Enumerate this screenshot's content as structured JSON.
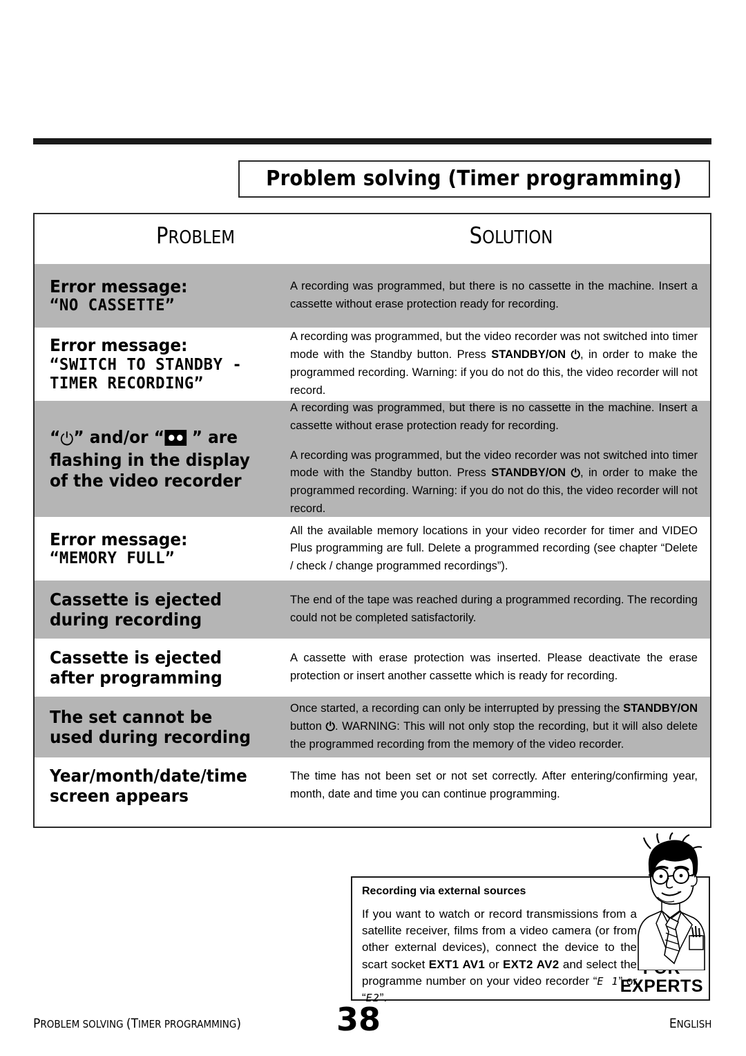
{
  "header": {
    "chapter_title": "Problem solving (Timer programming)"
  },
  "table": {
    "col_problem_header_first": "P",
    "col_problem_header_rest": "ROBLEM",
    "col_solution_header_first": "S",
    "col_solution_header_rest": "OLUTION",
    "rows": [
      {
        "shaded": true,
        "problem_lines": [
          {
            "text": "Error message:",
            "style": "normal"
          },
          {
            "text": "“NO  CASSETTE”",
            "style": "mono"
          }
        ],
        "solution_paragraphs": [
          "A recording was programmed, but there is no cassette in the machine. Insert a cassette without erase protection ready for recording."
        ]
      },
      {
        "shaded": false,
        "problem_lines": [
          {
            "text": "Error message:",
            "style": "normal"
          },
          {
            "text": "“SWITCH TO STANDBY -",
            "style": "mono"
          },
          {
            "text": "TIMER RECORDING”",
            "style": "mono"
          }
        ],
        "solution_paragraphs": [
          "A recording was programmed, but the video recorder was not switched into timer mode with the Standby button. Press STANDBY/ON ⏻, in order to make the programmed recording. Warning: if you do not do this, the video recorder will not record."
        ]
      },
      {
        "shaded": true,
        "problem_lines": [
          {
            "text": "“⏻” and/or “[cassette]” are",
            "style": "icons"
          },
          {
            "text": "flashing in the display",
            "style": "normal"
          },
          {
            "text": "of the video recorder",
            "style": "normal"
          }
        ],
        "solution_paragraphs": [
          "A recording was programmed, but there is no cassette in the machine. Insert a cassette without erase protection ready for recording.",
          "A recording was programmed, but the video recorder was not switched into timer mode with the Standby button. Press STANDBY/ON ⏻, in order to make the programmed recording. Warning: if you do not do this, the video recorder will not record."
        ]
      },
      {
        "shaded": false,
        "problem_lines": [
          {
            "text": "Error message:",
            "style": "normal"
          },
          {
            "text": "“MEMORY  FULL”",
            "style": "mono"
          }
        ],
        "solution_paragraphs": [
          "All the available memory locations in your video recorder for timer and VIDEO Plus programming are full. Delete a programmed recording (see chapter “Delete / check / change programmed recordings”)."
        ]
      },
      {
        "shaded": true,
        "problem_lines": [
          {
            "text": "Cassette is ejected",
            "style": "normal"
          },
          {
            "text": "during recording",
            "style": "normal"
          }
        ],
        "solution_paragraphs": [
          "The end of the tape was reached during a programmed recording. The recording could not be completed satisfactorily."
        ]
      },
      {
        "shaded": false,
        "problem_lines": [
          {
            "text": "Cassette is ejected",
            "style": "normal"
          },
          {
            "text": "after programming",
            "style": "normal"
          }
        ],
        "solution_paragraphs": [
          "A cassette with erase protection was inserted. Please deactivate the erase protection or insert another cassette which is ready for recording."
        ]
      },
      {
        "shaded": true,
        "problem_lines": [
          {
            "text": "The set cannot be",
            "style": "normal"
          },
          {
            "text": "used during recording",
            "style": "normal"
          }
        ],
        "solution_paragraphs": [
          "Once started, a recording can only be interrupted by pressing the STANDBY/ON button ⏻. WARNING: This will not only stop the recording, but it will also delete the programmed recording from the memory of the video recorder."
        ]
      },
      {
        "shaded": false,
        "problem_lines": [
          {
            "text": "Year/month/date/time",
            "style": "normal"
          },
          {
            "text": "screen appears",
            "style": "normal"
          }
        ],
        "solution_paragraphs": [
          "The time has not been set or not set correctly. After entering/confirming year, month, date and time you can continue programming."
        ]
      }
    ]
  },
  "experts": {
    "title": "Recording via external sources",
    "body_part1": "If you want to watch or record transmissions from a satellite receiver, films from a video camera (or from other external devices), connect the device to the scart socket ",
    "socket1": "EXT1 AV1",
    "body_part2": " or ",
    "socket2": "EXT2 AV2",
    "body_part3": " and select the programme number on your video recorder “",
    "lcd1": "E 1",
    "body_part4": "” or “",
    "lcd2": "E2",
    "body_part5": "”.",
    "badge_line1": "FOR",
    "badge_line2": "EXPERTS"
  },
  "footer": {
    "left_first": "P",
    "left_rest": "ROBLEM SOLVING ",
    "left_paren_open": "(",
    "left_t": "T",
    "left_rest2": "IMER PROGRAMMING",
    "left_paren_close": ")",
    "page_number": "38",
    "right_first": "E",
    "right_rest": "NGLISH"
  }
}
